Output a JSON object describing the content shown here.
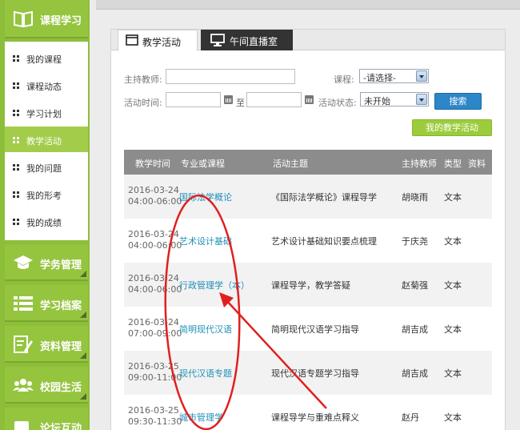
{
  "sidebar": {
    "course_section": {
      "label": "课程学习",
      "icon": "open-book-icon"
    },
    "items": [
      {
        "label": "我的课程",
        "active": false
      },
      {
        "label": "课程动态",
        "active": false
      },
      {
        "label": "学习计划",
        "active": false
      },
      {
        "label": "教学活动",
        "active": true
      },
      {
        "label": "我的问题",
        "active": false
      },
      {
        "label": "我的形考",
        "active": false
      },
      {
        "label": "我的成绩",
        "active": false
      }
    ],
    "sections": [
      {
        "label": "学务管理",
        "icon": "graduation-cap-icon"
      },
      {
        "label": "学习档案",
        "icon": "list-icon"
      },
      {
        "label": "资料管理",
        "icon": "edit-document-icon"
      },
      {
        "label": "校园生活",
        "icon": "people-icon"
      },
      {
        "label": "论坛互动",
        "icon": "chat-icon"
      }
    ]
  },
  "tabs": [
    {
      "label": "教学活动",
      "icon": "window-icon",
      "active": true
    },
    {
      "label": "午间直播室",
      "icon": "monitor-icon",
      "active": false
    }
  ],
  "filters": {
    "teacher_label": "主持教师:",
    "teacher_value": "",
    "course_label": "课程:",
    "course_selected": "-请选择-",
    "time_label": "活动时间:",
    "time_from": "",
    "time_to": "",
    "to_label": "至",
    "status_label": "活动状态:",
    "status_selected": "未开始",
    "search_label": "搜索",
    "my_activity_label": "我的教学活动"
  },
  "table": {
    "headers": [
      "教学时间",
      "专业或课程",
      "活动主题",
      "主持教师",
      "类型",
      "资料"
    ],
    "rows": [
      {
        "date": "2016-03-24",
        "time": "04:00-06:00",
        "course": "国际法学概论",
        "topic": "《国际法学概论》课程导学",
        "host": "胡晓雨",
        "type": "文本"
      },
      {
        "date": "2016-03-24",
        "time": "04:00-06:00",
        "course": "艺术设计基础",
        "topic": "艺术设计基础知识要点梳理",
        "host": "于庆尧",
        "type": "文本"
      },
      {
        "date": "2016-03-24",
        "time": "04:00-06:00",
        "course": "行政管理学（本）",
        "topic": "课程导学，教学答疑",
        "host": "赵菊强",
        "type": "文本"
      },
      {
        "date": "2016-03-24",
        "time": "07:00-09:00",
        "course": "简明现代汉语",
        "topic": "简明现代汉语学习指导",
        "host": "胡吉成",
        "type": "文本"
      },
      {
        "date": "2016-03-25",
        "time": "09:00-11:00",
        "course": "现代汉语专题",
        "topic": "现代汉语专题学习指导",
        "host": "胡吉成",
        "type": "文本"
      },
      {
        "date": "2016-03-25",
        "time": "09:30-11:30",
        "course": "城市管理学",
        "topic": "课程导学与重难点释义",
        "host": "赵丹",
        "type": "文本"
      }
    ]
  },
  "colors": {
    "sidebar_green": "#8dbe3a",
    "active_green": "#a3cc4b",
    "link_blue": "#1f8fb8",
    "search_blue": "#2c86c8",
    "annotation_red": "#e02020"
  }
}
